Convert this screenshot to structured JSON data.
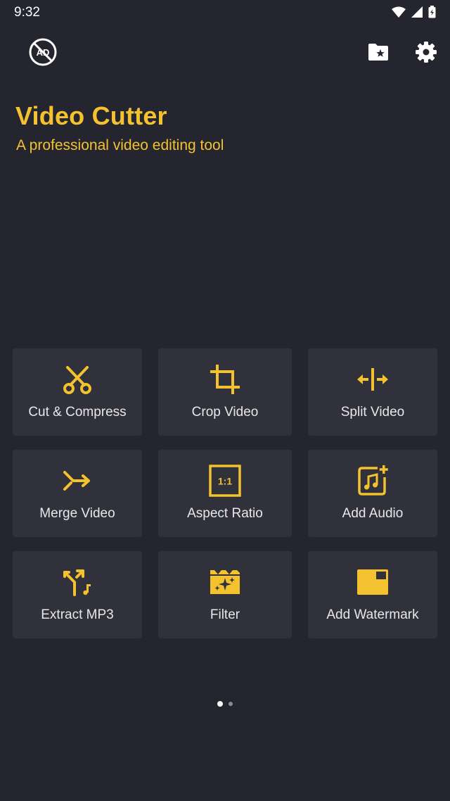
{
  "status_bar": {
    "time": "9:32",
    "icons": [
      "wifi-icon",
      "signal-icon",
      "battery-icon"
    ]
  },
  "top_bar": {
    "left_icon": "no-ads-icon",
    "right_icons": [
      "folder-star-icon",
      "settings-gear-icon"
    ]
  },
  "header": {
    "title": "Video Cutter",
    "subtitle": "A professional video editing tool"
  },
  "colors": {
    "background": "#24252e",
    "tile": "#30313b",
    "accent": "#f3c22e"
  },
  "tools": [
    {
      "label": "Cut & Compress",
      "icon": "scissors-icon"
    },
    {
      "label": "Crop Video",
      "icon": "crop-icon"
    },
    {
      "label": "Split Video",
      "icon": "split-icon"
    },
    {
      "label": "Merge Video",
      "icon": "merge-icon"
    },
    {
      "label": "Aspect Ratio",
      "icon": "aspect-ratio-icon",
      "icon_text": "1:1"
    },
    {
      "label": "Add Audio",
      "icon": "add-audio-icon"
    },
    {
      "label": "Extract MP3",
      "icon": "extract-mp3-icon"
    },
    {
      "label": "Filter",
      "icon": "filter-icon"
    },
    {
      "label": "Add Watermark",
      "icon": "watermark-icon"
    }
  ],
  "pager": {
    "pages": 2,
    "current": 1
  }
}
